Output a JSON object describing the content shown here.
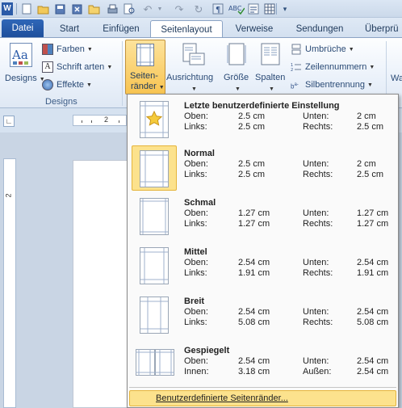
{
  "quick_access": {
    "word_icon": "W",
    "icons": [
      "new-doc-icon",
      "open-icon",
      "save-icon",
      "close-icon",
      "folder-icon",
      "print-icon",
      "undo-icon",
      "undo-dropdown-icon",
      "redo-icon",
      "refresh-icon",
      "spelling-icon",
      "format-icon",
      "table-icon",
      "customize-icon"
    ]
  },
  "tabs": {
    "file": "Datei",
    "start": "Start",
    "insert": "Einfügen",
    "layout": "Seitenlayout",
    "references": "Verweise",
    "mailings": "Sendungen",
    "review": "Überprü"
  },
  "ribbon": {
    "designs": "Designs",
    "colors": "Farben",
    "fonts": "Schrift arten",
    "effects": "Effekte",
    "group_designs": "Designs",
    "margins_line1": "Seiten-",
    "margins_line2": "ränder",
    "orientation": "Ausrichtung",
    "size": "Größe",
    "columns": "Spalten",
    "breaks": "Umbrüche",
    "line_numbers": "Zeilennummern",
    "hyphenation": "Silbentrennung",
    "cut_off": "Wa"
  },
  "ruler": {
    "tick": "2",
    "vertical_tick": "2"
  },
  "margins_menu": {
    "items": [
      {
        "title": "Letzte benutzerdefinierte Einstellung",
        "l1": "Oben:",
        "v1": "2.5   cm",
        "l2": "Unten:",
        "v2": "2   cm",
        "l3": "Links:",
        "v3": "2.5   cm",
        "l4": "Rechts:",
        "v4": "2.5   cm"
      },
      {
        "title": "Normal",
        "l1": "Oben:",
        "v1": "2.5   cm",
        "l2": "Unten:",
        "v2": "2   cm",
        "l3": "Links:",
        "v3": "2.5   cm",
        "l4": "Rechts:",
        "v4": "2.5   cm"
      },
      {
        "title": "Schmal",
        "l1": "Oben:",
        "v1": "1.27   cm",
        "l2": "Unten:",
        "v2": "1.27   cm",
        "l3": "Links:",
        "v3": "1.27   cm",
        "l4": "Rechts:",
        "v4": "1.27   cm"
      },
      {
        "title": "Mittel",
        "l1": "Oben:",
        "v1": "2.54   cm",
        "l2": "Unten:",
        "v2": "2.54   cm",
        "l3": "Links:",
        "v3": "1.91   cm",
        "l4": "Rechts:",
        "v4": "1.91   cm"
      },
      {
        "title": "Breit",
        "l1": "Oben:",
        "v1": "2.54   cm",
        "l2": "Unten:",
        "v2": "2.54   cm",
        "l3": "Links:",
        "v3": "5.08   cm",
        "l4": "Rechts:",
        "v4": "5.08   cm"
      },
      {
        "title": "Gespiegelt",
        "l1": "Oben:",
        "v1": "2.54   cm",
        "l2": "Unten:",
        "v2": "2.54   cm",
        "l3": "Innen:",
        "v3": "3.18   cm",
        "l4": "Außen:",
        "v4": "2.54   cm"
      }
    ],
    "custom": "Benutzerdefinierte Seitenränder..."
  }
}
